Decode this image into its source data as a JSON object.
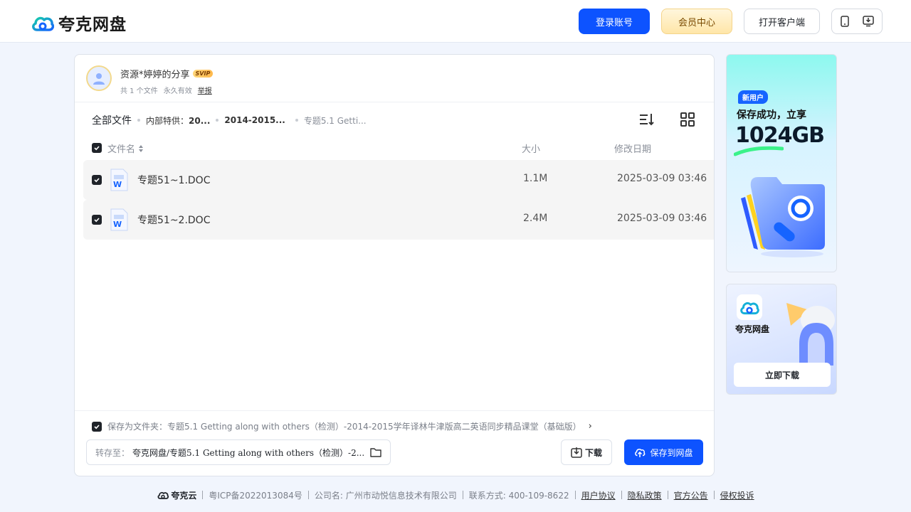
{
  "header": {
    "logo_text": "夸克网盘",
    "login_label": "登录账号",
    "vip_label": "会员中心",
    "client_label": "打开客户端"
  },
  "share": {
    "owner_name": "资源*婷婷的分享",
    "badge": "SVIP",
    "file_count": "共 1 个文件",
    "validity": "永久有效",
    "report": "举报"
  },
  "breadcrumb": {
    "root": "全部文件",
    "level1_prefix": "内部特供：",
    "level1_rest": "20...",
    "level2": "2014-2015...",
    "level3": "专题5.1 Getti..."
  },
  "table": {
    "col_name": "文件名",
    "col_size": "大小",
    "col_date": "修改日期",
    "rows": [
      {
        "name": "专题51~1.DOC",
        "size": "1.1M",
        "date": "2025-03-09 03:46"
      },
      {
        "name": "专题51~2.DOC",
        "size": "2.4M",
        "date": "2025-03-09 03:46"
      }
    ]
  },
  "bottom": {
    "save_folder": "保存为文件夹：专题5.1 Getting along with others（检测）-2014-2015学年译林牛津版高二英语同步精品课堂（基础版）",
    "dest_label": "转存至：",
    "dest_path": "夸克网盘/专题5.1 Getting along with others（检测）-2...",
    "download_label": "下载",
    "save_label": "保存到网盘"
  },
  "ads": {
    "tag": "新用户",
    "line1": "保存成功，立享",
    "line2": "1024GB",
    "brand": "夸克网盘",
    "download": "立即下载"
  },
  "footer": {
    "brand": "夸克云",
    "icp": "粤ICP备2022013084号",
    "company": "公司名: 广州市动悦信息技术有限公司",
    "contact": "联系方式: 400-109-8622",
    "links": [
      "用户协议",
      "隐私政策",
      "官方公告",
      "侵权投诉"
    ]
  },
  "colors": {
    "primary": "#0d53ff",
    "vip_bg": "#ffe6a8",
    "row_bg": "#f5f5f5",
    "page_bg": "#f1f5fd"
  }
}
